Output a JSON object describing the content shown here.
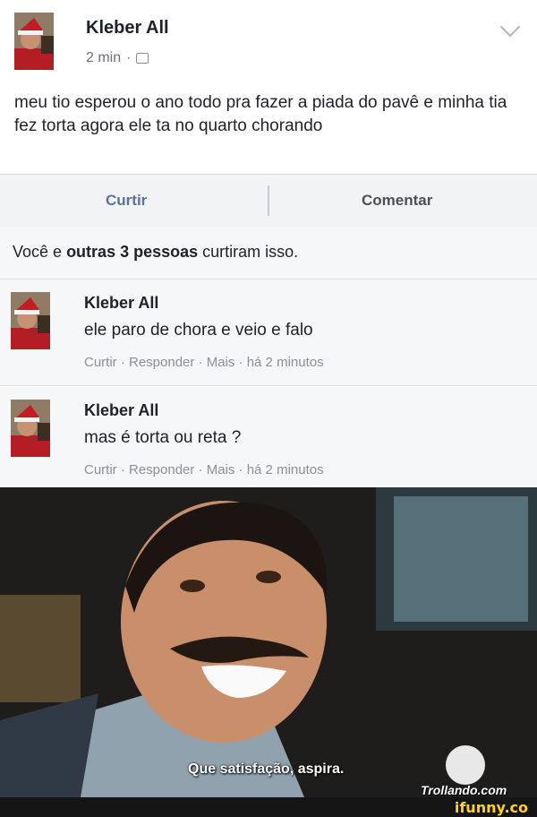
{
  "post": {
    "author": "Kleber All",
    "time": "2 min",
    "text": "meu tio esperou o ano todo pra fazer a piada do pavê e minha tia fez torta agora ele ta no quarto chorando"
  },
  "actions": {
    "like_label": "Curtir",
    "comment_label": "Comentar"
  },
  "likes": {
    "prefix": "Você e",
    "bold": "outras 3 pessoas",
    "suffix": "curtiram isso."
  },
  "comments": [
    {
      "author": "Kleber All",
      "text": "ele paro de chora e veio e falo",
      "meta": "Curtir · Responder · Mais · há 2 minutos"
    },
    {
      "author": "Kleber All",
      "text": "mas é torta ou reta ?",
      "meta": "Curtir · Responder · Mais · há 2 minutos"
    }
  ],
  "meme": {
    "subtitle": "Que satisfação, aspira.",
    "watermark": "Trollando.com"
  },
  "footer": {
    "brand": "ifunny.co"
  },
  "colors": {
    "like_blue": "#5b6fa5",
    "meta_gray": "#8a8f99",
    "ifunny_yellow": "#ffd21f"
  }
}
